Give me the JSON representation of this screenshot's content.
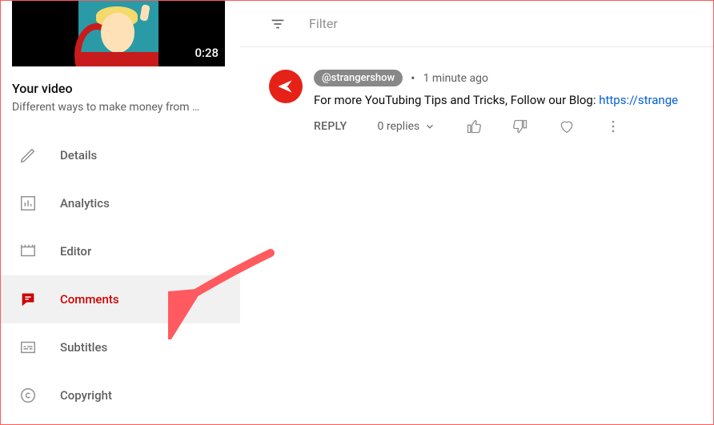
{
  "sidebar": {
    "thumbnail": {
      "duration": "0:28"
    },
    "heading": "Your video",
    "video_title": "Different ways to make money from …",
    "items": [
      {
        "label": "Details",
        "icon": "pencil-icon",
        "active": false
      },
      {
        "label": "Analytics",
        "icon": "analytics-icon",
        "active": false
      },
      {
        "label": "Editor",
        "icon": "editor-icon",
        "active": false
      },
      {
        "label": "Comments",
        "icon": "comments-icon",
        "active": true
      },
      {
        "label": "Subtitles",
        "icon": "subtitles-icon",
        "active": false
      },
      {
        "label": "Copyright",
        "icon": "copyright-icon",
        "active": false
      }
    ]
  },
  "filter": {
    "label": "Filter"
  },
  "comment": {
    "author_handle": "@strangershow",
    "time_ago": "1 minute ago",
    "text_prefix": "For more YouTubing Tips and Tricks, Follow our Blog: ",
    "link_text": "https://strange",
    "reply_label": "REPLY",
    "replies_label": "0 replies"
  }
}
